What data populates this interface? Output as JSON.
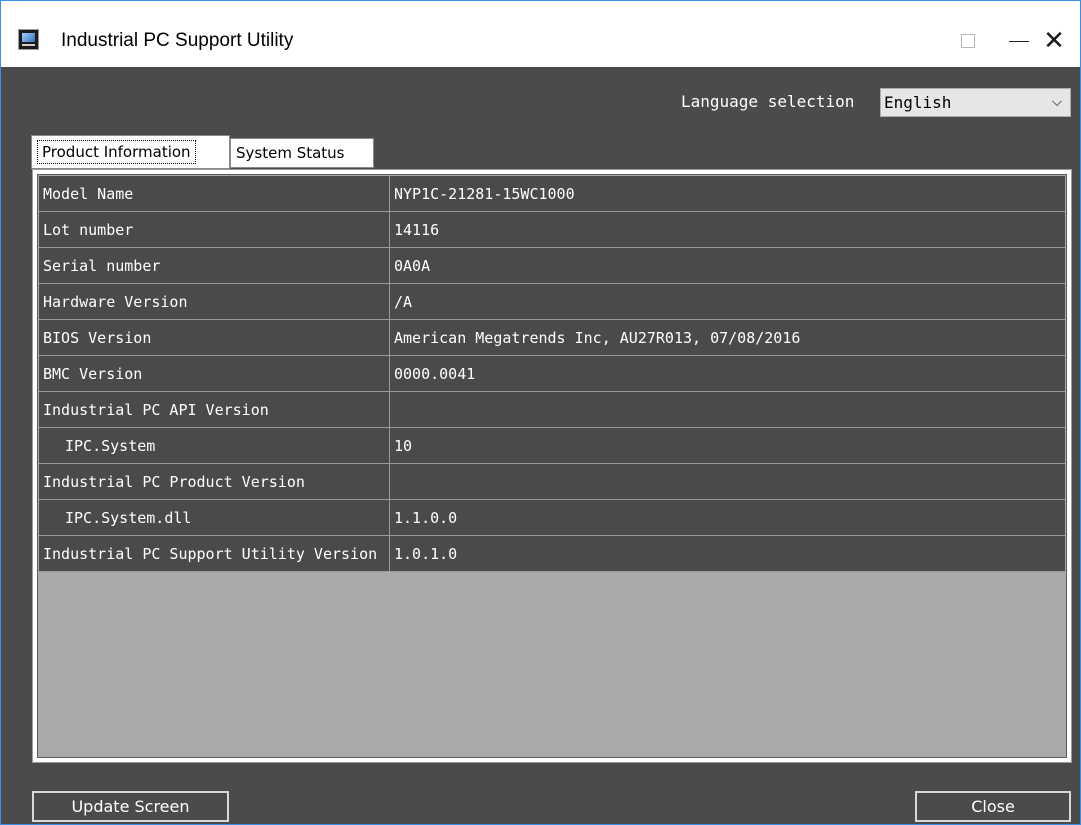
{
  "window": {
    "title": "Industrial PC Support Utility"
  },
  "language": {
    "label": "Language selection",
    "selected": "English"
  },
  "tabs": [
    {
      "label": "Product Information",
      "active": true
    },
    {
      "label": "System Status",
      "active": false
    }
  ],
  "table": {
    "rows": [
      {
        "name": "Model Name",
        "value": "NYP1C-21281-15WC1000"
      },
      {
        "name": "Lot number",
        "value": "14116"
      },
      {
        "name": "Serial number",
        "value": "0A0A"
      },
      {
        "name": "Hardware Version",
        "value": "/A"
      },
      {
        "name": "BIOS Version",
        "value": "American Megatrends Inc, AU27R013, 07/08/2016"
      },
      {
        "name": "BMC Version",
        "value": "0000.0041"
      },
      {
        "name": "Industrial PC API Version",
        "value": ""
      },
      {
        "name": "IPC.System",
        "value": "10"
      },
      {
        "name": "Industrial PC Product Version",
        "value": ""
      },
      {
        "name": "IPC.System.dll",
        "value": "1.1.0.0"
      },
      {
        "name": "Industrial PC Support Utility Version",
        "value": "1.0.1.0"
      }
    ]
  },
  "buttons": {
    "update": "Update Screen",
    "close": "Close"
  },
  "colors": {
    "background": "#4b4b4b",
    "row": "#4a4a4a",
    "empty_grid": "#a9a9a9"
  }
}
